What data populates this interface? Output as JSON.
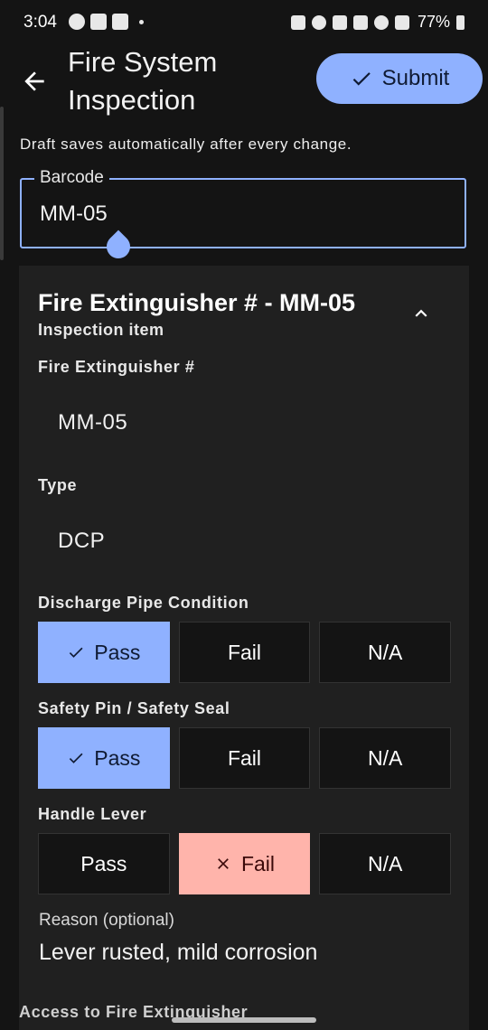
{
  "status_bar": {
    "time": "3:04",
    "battery": "77%",
    "left_icons": [
      "whatsapp-icon",
      "linkedin-icon",
      "youtube-icon"
    ],
    "right_icons": [
      "screenshot-icon",
      "alarm-icon",
      "bluetooth-icon",
      "mute-icon",
      "wifi-icon",
      "signal-icon"
    ]
  },
  "app_bar": {
    "title": "Fire System Inspection",
    "submit_label": "Submit"
  },
  "draft_note": "Draft saves automatically after every change.",
  "barcode": {
    "label": "Barcode",
    "value": "MM-05"
  },
  "card": {
    "title": "Fire Extinguisher # - MM-05",
    "subtitle": "Inspection item",
    "fields": [
      {
        "label": "Fire Extinguisher #",
        "value": "MM-05"
      },
      {
        "label": "Type",
        "value": "DCP"
      }
    ],
    "checks": [
      {
        "label": "Discharge Pipe Condition",
        "options": [
          "Pass",
          "Fail",
          "N/A"
        ],
        "selected": "Pass"
      },
      {
        "label": "Safety Pin / Safety Seal",
        "options": [
          "Pass",
          "Fail",
          "N/A"
        ],
        "selected": "Pass"
      },
      {
        "label": "Handle Lever",
        "options": [
          "Pass",
          "Fail",
          "N/A"
        ],
        "selected": "Fail"
      }
    ],
    "reason": {
      "label": "Reason (optional)",
      "value": "Lever rusted, mild corrosion"
    },
    "next_label": "Access to Fire Extinguisher"
  },
  "colors": {
    "accent": "#8fb1ff",
    "fail": "#ffb4ab",
    "background": "#141414",
    "card": "#202020"
  }
}
